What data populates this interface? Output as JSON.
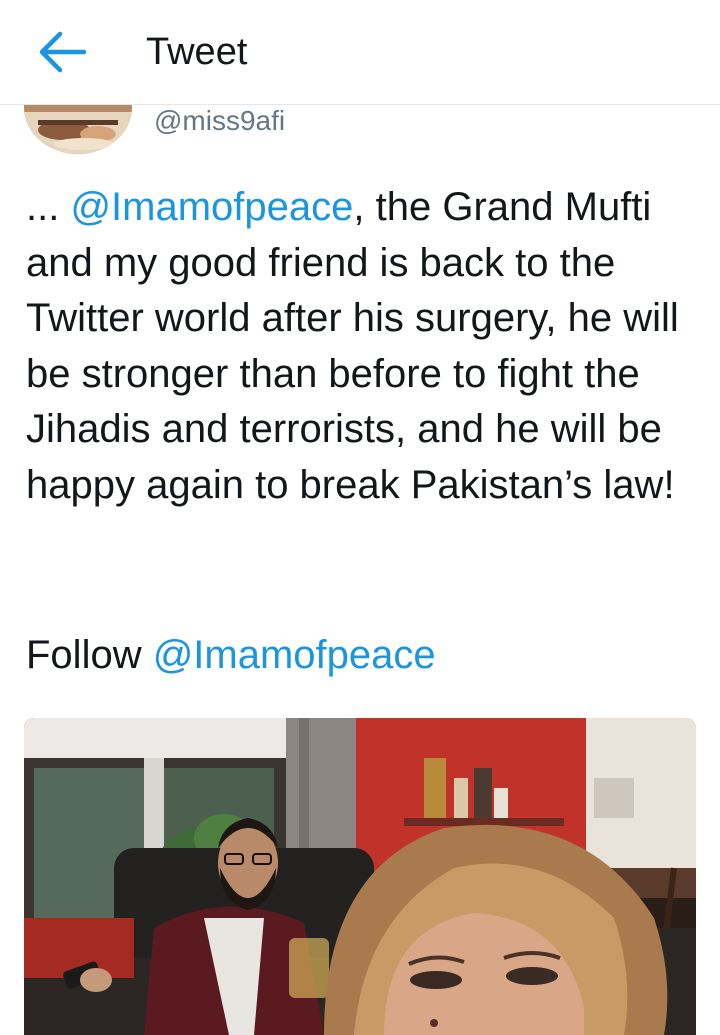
{
  "header": {
    "back_icon": "arrow-left-icon",
    "title": "Tweet",
    "accent_color": "#1b95e0"
  },
  "author": {
    "handle": "@miss9afi"
  },
  "tweet": {
    "text_before": "... ",
    "mention": "@Imamofpeace",
    "text_after": ", the Grand Mufti and my good friend is back to the Twitter world after his surgery, he will be stronger than before to fight the Jihadis and terrorists, and he will be happy again to break Pakistan’s law!",
    "follow_text": "Follow ",
    "follow_mention": "@Imamofpeace"
  },
  "media": {
    "type": "photo"
  }
}
